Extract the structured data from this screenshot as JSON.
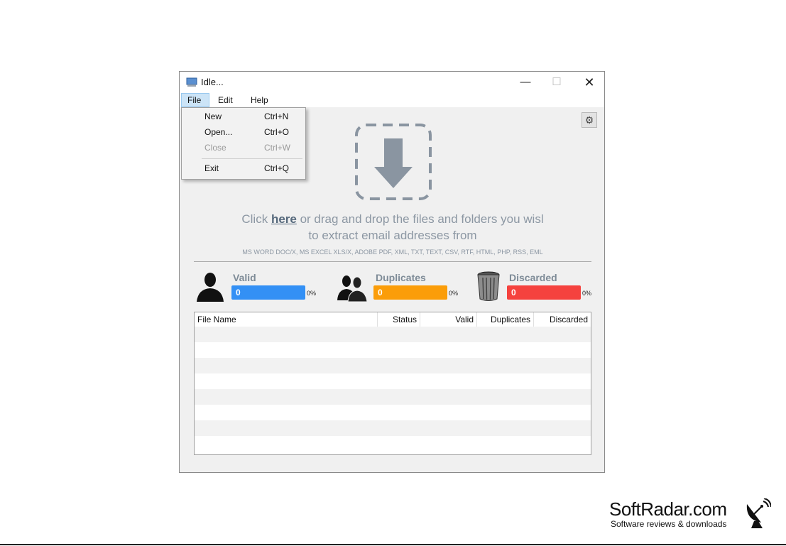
{
  "window": {
    "title": "Idle...",
    "minimize": "—",
    "maximize": "☐",
    "close": "✕"
  },
  "menubar": {
    "file": "File",
    "edit": "Edit",
    "help": "Help"
  },
  "file_menu": [
    {
      "label": "New",
      "shortcut": "Ctrl+N"
    },
    {
      "label": "Open...",
      "shortcut": "Ctrl+O"
    },
    {
      "label": "Close",
      "shortcut": "Ctrl+W"
    },
    {
      "label": "Exit",
      "shortcut": "Ctrl+Q"
    }
  ],
  "settings_icon": "⚙",
  "drop_zone": {
    "prompt_pre": "Click ",
    "prompt_link": "here",
    "prompt_post": " or drag and drop the files and folders you wisl",
    "prompt_line2": "to extract email addresses from",
    "formats": "MS WORD DOC/X, MS EXCEL XLS/X, ADOBE PDF, XML, TXT, TEXT, CSV, RTF, HTML, PHP, RSS, EML"
  },
  "stats": {
    "valid": {
      "label": "Valid",
      "count": "0",
      "percent": "0%",
      "color": "#3390f5"
    },
    "duplicates": {
      "label": "Duplicates",
      "count": "0",
      "percent": "0%",
      "color": "#fb9d09"
    },
    "discarded": {
      "label": "Discarded",
      "count": "0",
      "percent": "0%",
      "color": "#f5423e"
    }
  },
  "table": {
    "columns": [
      "File Name",
      "Status",
      "Valid",
      "Duplicates",
      "Discarded"
    ]
  },
  "watermark": {
    "brand": "SoftRadar.com",
    "tagline": "Software reviews & downloads"
  }
}
